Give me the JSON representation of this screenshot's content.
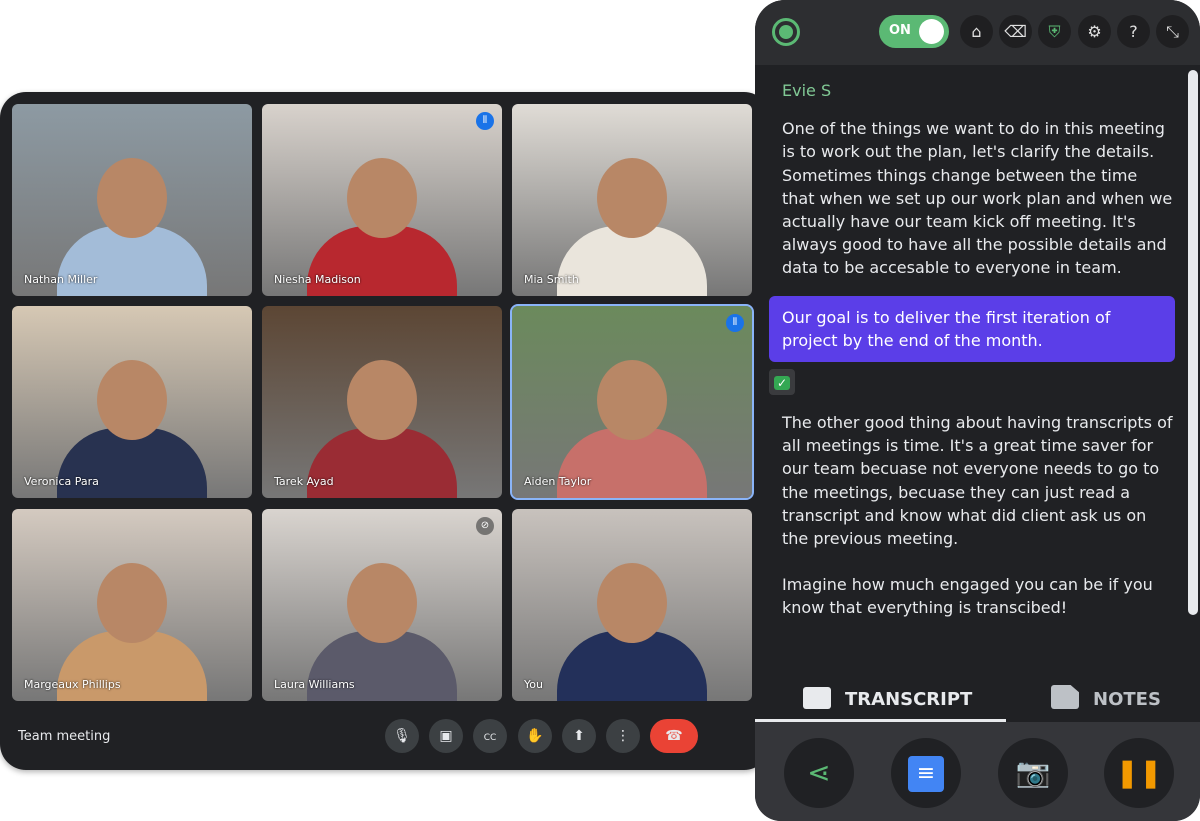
{
  "meeting": {
    "title": "Team meeting",
    "participants": [
      {
        "name": "Nathan Miller"
      },
      {
        "name": "Niesha Madison",
        "speaking": true
      },
      {
        "name": "Mia Smith"
      },
      {
        "name": "Veronica Para"
      },
      {
        "name": "Tarek Ayad"
      },
      {
        "name": "Aiden Taylor",
        "speaking": true,
        "active": true
      },
      {
        "name": "Margeaux Phillips"
      },
      {
        "name": "Laura Williams",
        "muted": true
      },
      {
        "name": "You"
      }
    ],
    "controls": [
      "mic-icon",
      "camera-icon",
      "captions-icon",
      "raise-hand-icon",
      "present-icon",
      "more-icon",
      "end-call-icon"
    ],
    "end_call_color": "#ea4335"
  },
  "panel": {
    "toggle_label": "ON",
    "accent": "#5bb974",
    "header_icons": [
      "home-icon",
      "eraser-icon",
      "shield-check-icon",
      "gear-icon",
      "help-icon",
      "collapse-icon"
    ],
    "speaker": "Evie S",
    "paragraphs": [
      "One of the things we want to do in this meeting is to work out the plan, let's clarify the details. Sometimes things change between the time that when we set up our work plan and when we actually have our team kick off meeting. It's always good to have all the possible details and data to be accesable to everyone in team.",
      "Our goal is to deliver the first iteration of project by the end of the month.",
      "The other good thing about having transcripts of all meetings is time. It's a great time saver for our team becuase not everyone needs to go to the meetings, becuase they can just read a transcript and know what did client ask us on the previous meeting.",
      "Imagine how much engaged you can be if you know that everything is transcibed!"
    ],
    "highlight_color": "#5b3ee8",
    "check_mark": "✓",
    "tabs": [
      {
        "label": "TRANSCRIPT",
        "active": true
      },
      {
        "label": "NOTES"
      }
    ],
    "bottom_buttons": [
      "share-icon",
      "document-icon",
      "camera-icon",
      "pause-icon"
    ]
  }
}
